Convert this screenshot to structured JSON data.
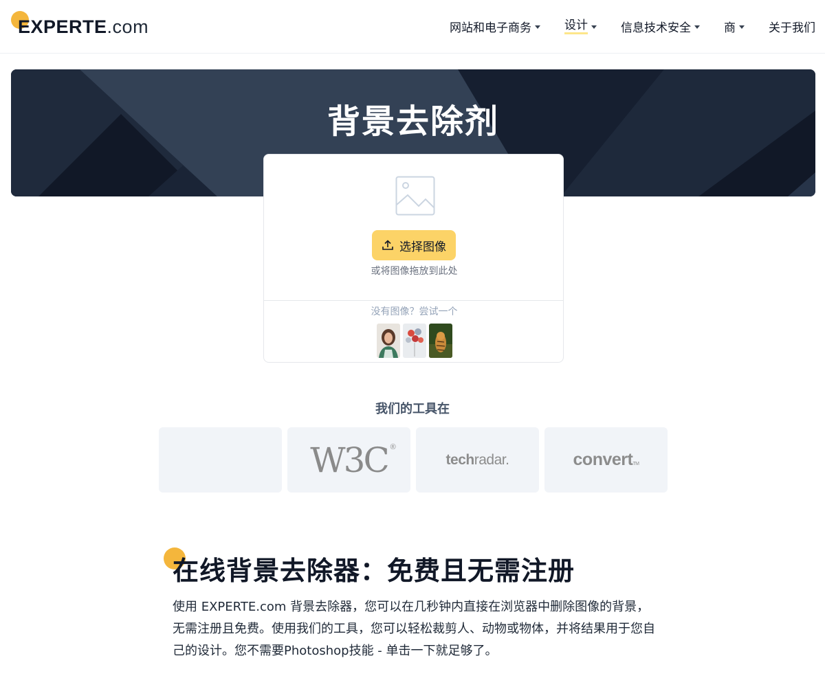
{
  "header": {
    "logo": {
      "brand": "EXPERTE",
      "suffix": ".com"
    },
    "nav": [
      {
        "label": "网站和电子商务",
        "caret": true,
        "active": false
      },
      {
        "label": "设计",
        "caret": true,
        "active": true
      },
      {
        "label": "信息技术安全",
        "caret": true,
        "active": false
      },
      {
        "label": "商",
        "caret": true,
        "active": false
      },
      {
        "label": "关于我们",
        "caret": false,
        "active": false
      }
    ]
  },
  "hero": {
    "title": "背景去除剂"
  },
  "uploader": {
    "image_icon": "image-placeholder-icon",
    "button_icon": "upload-icon",
    "button_label": "选择图像",
    "drop_hint": "或将图像拖放到此处",
    "try_label": "没有图像？尝试一个",
    "samples": [
      {
        "name": "sample-woman-portrait"
      },
      {
        "name": "sample-balloons"
      },
      {
        "name": "sample-tiger"
      }
    ]
  },
  "tools": {
    "title": "我们的工具在",
    "logos": [
      {
        "name": "blank-logo",
        "text": ""
      },
      {
        "name": "w3c-logo",
        "text": "W3C",
        "mark": "®"
      },
      {
        "name": "techradar-logo",
        "bold": "tech",
        "light": "radar."
      },
      {
        "name": "convert-logo",
        "text": "convert",
        "mark": "TM"
      }
    ]
  },
  "article": {
    "title": "在线背景去除器：免费且无需注册",
    "body": "使用 EXPERTE.com 背景去除器，您可以在几秒钟内直接在浏览器中删除图像的背景，无需注册且免费。使用我们的工具，您可以轻松裁剪人、动物或物体，并将结果用于您自己的设计。您不需要Photoshop技能 - 单击一下就足够了。"
  },
  "colors": {
    "accent": "#fcd367",
    "brand_dot": "#f4b63c",
    "hero_dark": "#1e293b",
    "logo_box": "#f1f4f8"
  }
}
